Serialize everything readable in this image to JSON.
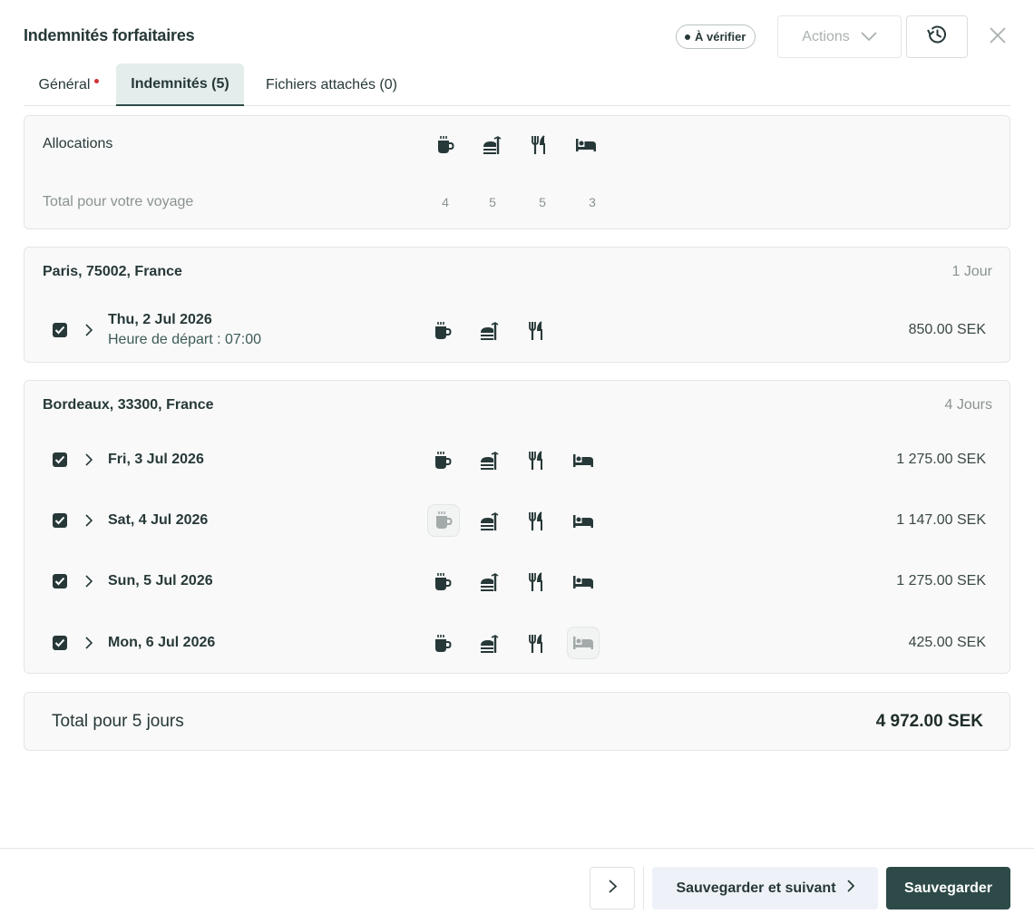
{
  "header": {
    "title": "Indemnités forfaitaires",
    "status_badge": "À vérifier",
    "actions_label": "Actions",
    "history_icon": "history-icon",
    "close_icon": "close-icon"
  },
  "tabs": [
    {
      "label": "Général",
      "required": true
    },
    {
      "label": "Indemnités (5)",
      "active": true
    },
    {
      "label": "Fichiers attachés (0)"
    }
  ],
  "allocations": {
    "label": "Allocations",
    "total_label": "Total pour votre voyage",
    "icons": [
      "coffee-icon",
      "lunch-icon",
      "dinner-icon",
      "bed-icon"
    ],
    "totals": [
      "4",
      "5",
      "5",
      "3"
    ]
  },
  "locations": [
    {
      "city": "Paris, 75002, France",
      "days": "1 Jour",
      "rows": [
        {
          "date": "Thu, 2 Jul 2026",
          "departure": "Heure de départ : 07:00",
          "amount": "850.00 SEK",
          "checked": true
        }
      ]
    },
    {
      "city": "Bordeaux, 33300, France",
      "days": "4 Jours",
      "rows": [
        {
          "date": "Fri, 3 Jul 2026",
          "amount": "1 275.00 SEK",
          "checked": true
        },
        {
          "date": "Sat, 4 Jul 2026",
          "amount": "1 147.00 SEK",
          "checked": true
        },
        {
          "date": "Sun, 5 Jul 2026",
          "amount": "1 275.00 SEK",
          "checked": true
        },
        {
          "date": "Mon, 6 Jul 2026",
          "amount": "425.00 SEK",
          "checked": true
        }
      ]
    }
  ],
  "total": {
    "label": "Total pour 5 jours",
    "value": "4 972.00 SEK"
  },
  "footer": {
    "next_icon": "chevron-right-icon",
    "save_next_label": "Sauvegarder et suivant",
    "save_label": "Sauvegarder"
  },
  "colors": {
    "primary": "#2e4a48",
    "required_dot": "#d1323a",
    "icon_active": "#273838",
    "icon_inactive": "#a3aaa9"
  }
}
